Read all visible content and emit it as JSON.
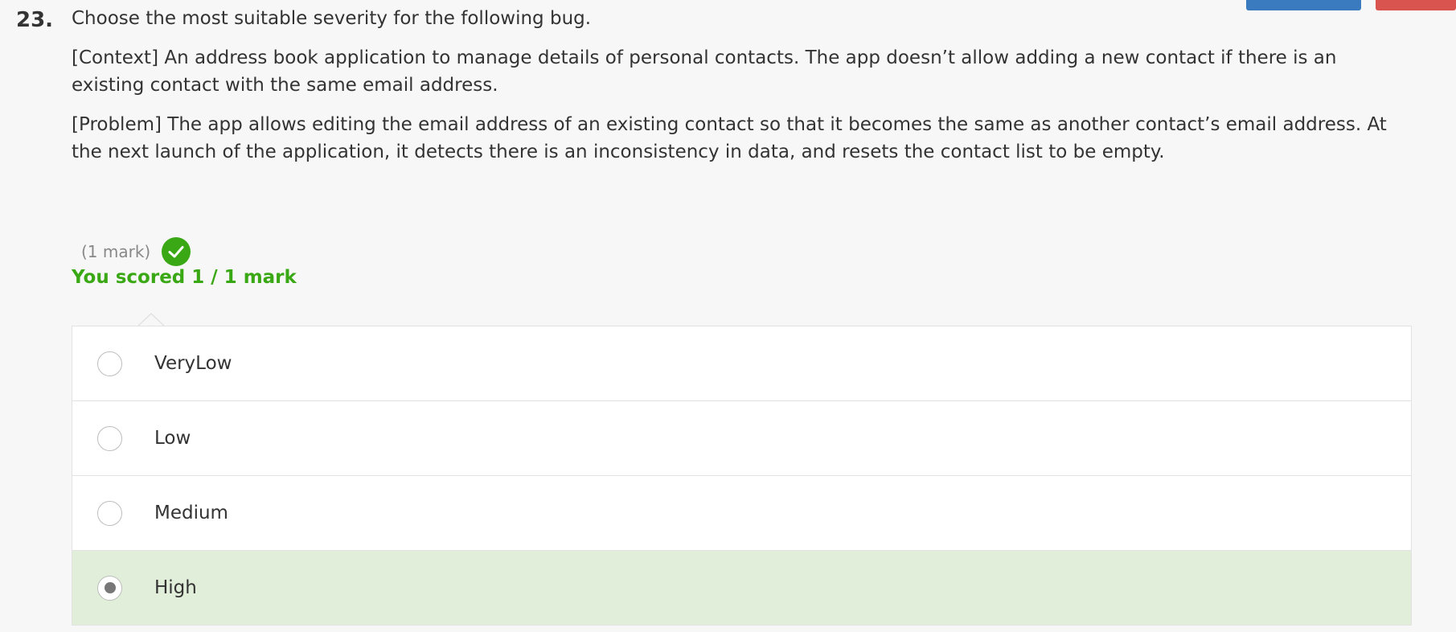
{
  "question": {
    "number": "23.",
    "prompt": "Choose the most suitable severity for the following bug.",
    "context": "[Context] An address book application to manage details of personal contacts. The app doesn’t allow adding a new contact if there is an existing contact with the same email address.",
    "problem": "[Problem] The app allows editing the email address of an existing contact so that it becomes the same as another contact’s email address. At the next launch of the application, it detects there is an inconsistency in data, and resets the contact list to be empty."
  },
  "marks": {
    "label": "(1 mark)",
    "status_icon": "check-circle-icon",
    "score_text": "You scored 1 / 1 mark"
  },
  "options": [
    {
      "label": "VeryLow",
      "selected": false
    },
    {
      "label": "Low",
      "selected": false
    },
    {
      "label": "Medium",
      "selected": false
    },
    {
      "label": "High",
      "selected": true
    }
  ],
  "colors": {
    "success": "#3aa815",
    "selected_bg": "#e1eed9",
    "primary_button": "#3a7bc0",
    "danger_button": "#d9534f"
  }
}
